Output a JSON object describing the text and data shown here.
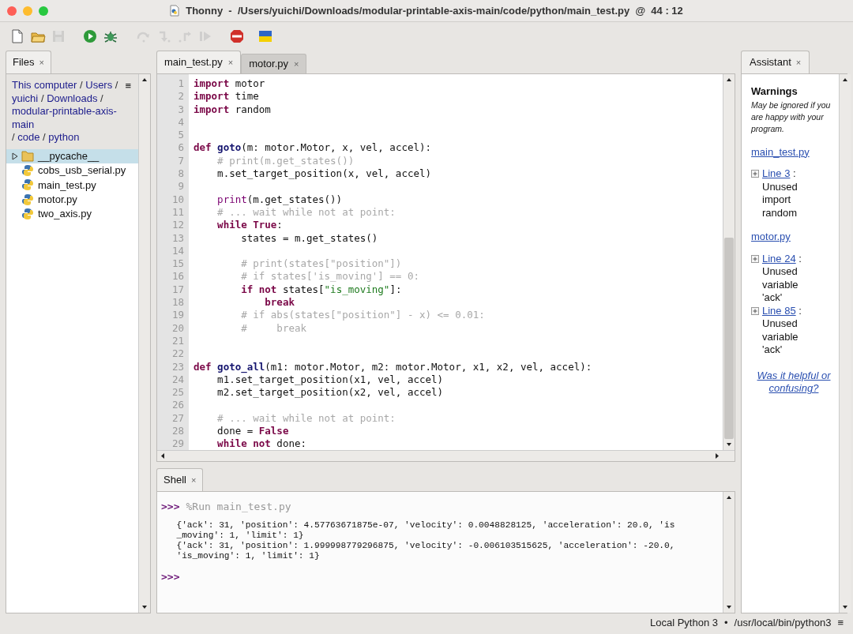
{
  "window": {
    "title": "Thonny  -  /Users/yuichi/Downloads/modular-printable-axis-main/code/python/main_test.py  @  44 : 12"
  },
  "toolbar": [
    {
      "kind": "new",
      "disabled": false
    },
    {
      "kind": "open",
      "disabled": false
    },
    {
      "kind": "save",
      "disabled": true
    },
    {
      "kind": "run",
      "disabled": false
    },
    {
      "kind": "debug",
      "disabled": false
    },
    {
      "kind": "step-over",
      "disabled": true
    },
    {
      "kind": "step-into",
      "disabled": true
    },
    {
      "kind": "step-out",
      "disabled": true
    },
    {
      "kind": "resume",
      "disabled": true
    },
    {
      "kind": "stop",
      "disabled": false
    },
    {
      "kind": "flag",
      "disabled": false
    }
  ],
  "files_panel": {
    "tab": "Files",
    "close": "×",
    "menu": "≡",
    "path": [
      "This computer",
      "/",
      "Users",
      "/",
      "yuichi",
      "/",
      "Downloads",
      "/",
      "modular-printable-axis-main",
      "/",
      "code",
      "/",
      "python"
    ],
    "tree": [
      {
        "name": "__pycache__",
        "kind": "folder",
        "selected": true,
        "expanded": false
      },
      {
        "name": "cobs_usb_serial.py",
        "kind": "python",
        "selected": false
      },
      {
        "name": "main_test.py",
        "kind": "python",
        "selected": false
      },
      {
        "name": "motor.py",
        "kind": "python",
        "selected": false
      },
      {
        "name": "two_axis.py",
        "kind": "python",
        "selected": false
      }
    ]
  },
  "editor": {
    "tabs": [
      {
        "label": "main_test.py",
        "close": "×",
        "selected": true
      },
      {
        "label": "motor.py",
        "close": "×",
        "selected": false
      }
    ],
    "lines": [
      {
        "num": "1",
        "tokens": [
          {
            "kind": "keyword",
            "text": "import"
          },
          {
            "kind": "plain",
            "text": " motor"
          }
        ]
      },
      {
        "num": "2",
        "tokens": [
          {
            "kind": "keyword",
            "text": "import"
          },
          {
            "kind": "plain",
            "text": " time"
          }
        ]
      },
      {
        "num": "3",
        "tokens": [
          {
            "kind": "keyword",
            "text": "import"
          },
          {
            "kind": "plain",
            "text": " random"
          }
        ]
      },
      {
        "num": "4"
      },
      {
        "num": "5"
      },
      {
        "num": "6",
        "tokens": [
          {
            "kind": "keyword",
            "text": "def "
          },
          {
            "kind": "defname",
            "text": "goto"
          },
          {
            "kind": "plain",
            "text": "(m: motor.Motor, x, vel, accel):"
          }
        ]
      },
      {
        "num": "7",
        "tokens": [
          {
            "kind": "comment",
            "text": "    # print(m.get_states())"
          }
        ]
      },
      {
        "num": "8",
        "tokens": [
          {
            "kind": "plain",
            "text": "    m.set_target_position(x, vel, accel)"
          }
        ]
      },
      {
        "num": "9"
      },
      {
        "num": "10",
        "tokens": [
          {
            "kind": "builtin",
            "text": "    print"
          },
          {
            "kind": "plain",
            "text": "(m.get_states())"
          }
        ]
      },
      {
        "num": "11",
        "tokens": [
          {
            "kind": "comment",
            "text": "    # ... wait while not at point:"
          }
        ]
      },
      {
        "num": "12",
        "tokens": [
          {
            "kind": "keyword",
            "text": "    while True"
          },
          {
            "kind": "plain",
            "text": ":"
          }
        ]
      },
      {
        "num": "13",
        "tokens": [
          {
            "kind": "plain",
            "text": "        states = m.get_states()"
          }
        ]
      },
      {
        "num": "14"
      },
      {
        "num": "15",
        "tokens": [
          {
            "kind": "comment",
            "text": "        # print(states[\"position\"])"
          }
        ]
      },
      {
        "num": "16",
        "tokens": [
          {
            "kind": "comment",
            "text": "        # if states['is_moving'] == 0:"
          }
        ]
      },
      {
        "num": "17",
        "tokens": [
          {
            "kind": "keyword",
            "text": "        if not"
          },
          {
            "kind": "plain",
            "text": " states["
          },
          {
            "kind": "string",
            "text": "\"is_moving\""
          },
          {
            "kind": "plain",
            "text": "]:"
          }
        ]
      },
      {
        "num": "18",
        "tokens": [
          {
            "kind": "keyword",
            "text": "            break"
          }
        ]
      },
      {
        "num": "19",
        "tokens": [
          {
            "kind": "comment",
            "text": "        # if abs(states[\"position\"] - x) <= 0.01:"
          }
        ]
      },
      {
        "num": "20",
        "tokens": [
          {
            "kind": "comment",
            "text": "        #     break"
          }
        ]
      },
      {
        "num": "21"
      },
      {
        "num": "22"
      },
      {
        "num": "23",
        "tokens": [
          {
            "kind": "keyword",
            "text": "def "
          },
          {
            "kind": "defname",
            "text": "goto_all"
          },
          {
            "kind": "plain",
            "text": "(m1: motor.Motor, m2: motor.Motor, x1, x2, vel, accel):"
          }
        ]
      },
      {
        "num": "24",
        "tokens": [
          {
            "kind": "plain",
            "text": "    m1.set_target_position(x1, vel, accel)"
          }
        ]
      },
      {
        "num": "25",
        "tokens": [
          {
            "kind": "plain",
            "text": "    m2.set_target_position(x2, vel, accel)"
          }
        ]
      },
      {
        "num": "26"
      },
      {
        "num": "27",
        "tokens": [
          {
            "kind": "comment",
            "text": "    # ... wait while not at point:"
          }
        ]
      },
      {
        "num": "28",
        "tokens": [
          {
            "kind": "plain",
            "text": "    done = "
          },
          {
            "kind": "keyword",
            "text": "False"
          }
        ]
      },
      {
        "num": "29",
        "tokens": [
          {
            "kind": "keyword",
            "text": "    while not"
          },
          {
            "kind": "plain",
            "text": " done:"
          }
        ]
      }
    ]
  },
  "shell": {
    "tab": "Shell",
    "close": "×",
    "entries": [
      {
        "kind": "command",
        "prompt": ">>>",
        "text": "%Run main_test.py"
      },
      {
        "kind": "output",
        "text": "  {'ack': 31, 'position': 4.57763671875e-07, 'velocity': 0.0048828125, 'acceleration': 20.0, 'is"
      },
      {
        "kind": "output",
        "text": "  _moving': 1, 'limit': 1}"
      },
      {
        "kind": "output",
        "text": "  {'ack': 31, 'position': 1.999998779296875, 'velocity': -0.006103515625, 'acceleration': -20.0,"
      },
      {
        "kind": "output",
        "text": "  'is_moving': 1, 'limit': 1}"
      },
      {
        "kind": "prompt",
        "prompt": ">>>"
      }
    ]
  },
  "assistant": {
    "tab": "Assistant",
    "close": "×",
    "heading": "Warnings",
    "subtitle": "May be ignored if you are happy with your program.",
    "sections": [
      {
        "file": "main_test.py",
        "items": [
          {
            "line": "Line 3",
            "sep": ":",
            "message": "Unused import random"
          }
        ]
      },
      {
        "file": "motor.py",
        "items": [
          {
            "line": "Line 24",
            "sep": ":",
            "message": "Unused variable 'ack'"
          },
          {
            "line": "Line 85",
            "sep": ":",
            "message": "Unused variable 'ack'"
          }
        ]
      }
    ],
    "feedback": "Was it helpful or confusing?"
  },
  "status_bar": {
    "interpreter": "Local Python 3",
    "separator": "•",
    "path": "/usr/local/bin/python3",
    "menu": "≡"
  }
}
